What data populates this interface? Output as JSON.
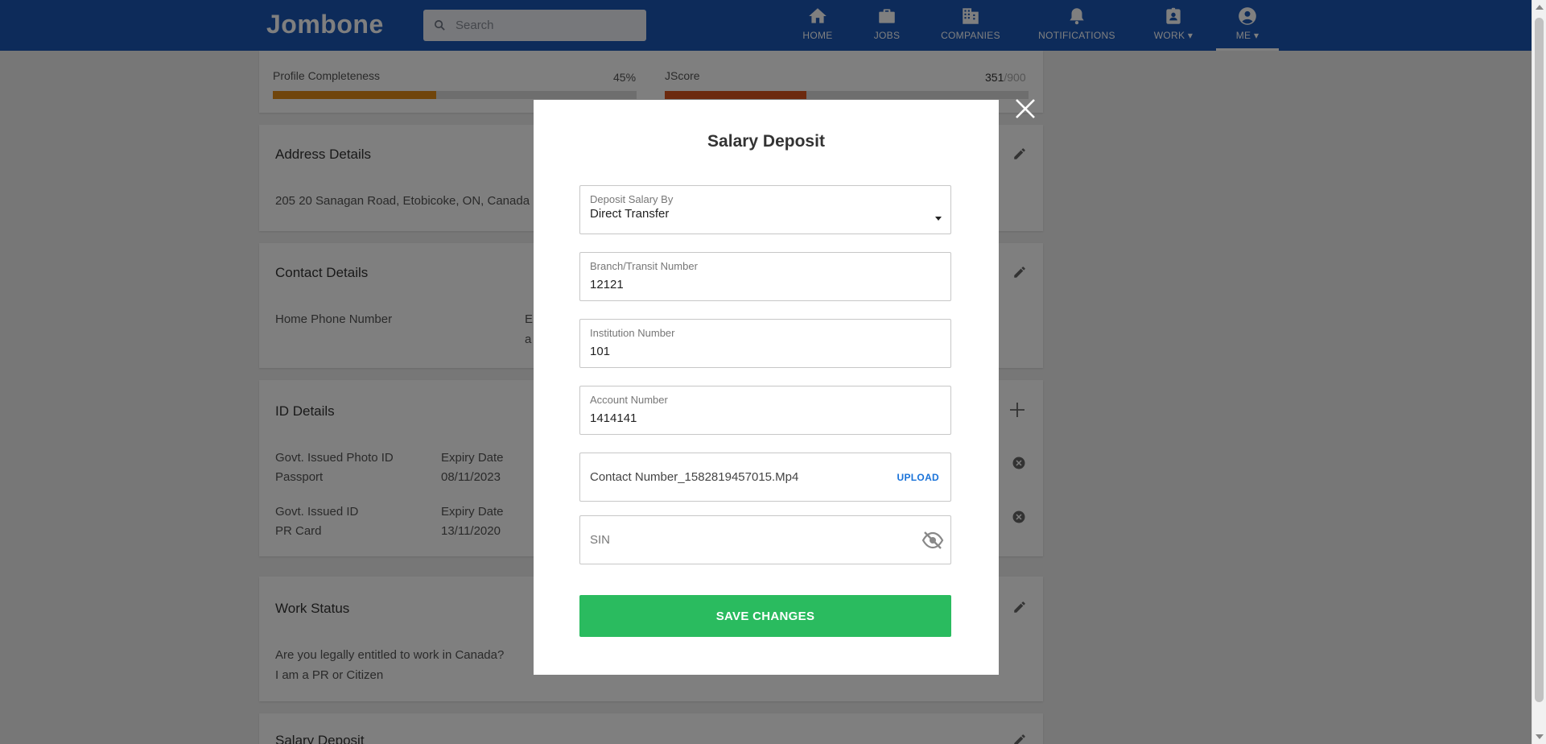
{
  "navbar": {
    "brand": "Jombone",
    "search_placeholder": "Search",
    "items": [
      {
        "label": "HOME",
        "icon": "home-icon"
      },
      {
        "label": "JOBS",
        "icon": "briefcase-icon"
      },
      {
        "label": "COMPANIES",
        "icon": "building-icon"
      },
      {
        "label": "NOTIFICATIONS",
        "icon": "bell-icon"
      },
      {
        "label": "WORK ▾",
        "icon": "work-badge-icon"
      },
      {
        "label": "ME ▾",
        "icon": "account-icon"
      }
    ]
  },
  "progress": {
    "profile_label": "Profile Completeness",
    "profile_value": "45%",
    "profile_fraction": 0.45,
    "jscore_label": "JScore",
    "jscore_value": "351",
    "jscore_max": "/900",
    "jscore_fraction": 0.39
  },
  "address": {
    "title": "Address Details",
    "value": "205 20 Sanagan Road, Etobicoke, ON, Canada"
  },
  "contact": {
    "title": "Contact Details",
    "home_phone_label": "Home Phone Number",
    "partial_e": "E",
    "partial_a": "a"
  },
  "id_details": {
    "title": "ID Details",
    "rows": [
      {
        "type_label": "Govt. Issued Photo ID",
        "type_value": "Passport",
        "expiry_label": "Expiry Date",
        "expiry_value": "08/11/2023"
      },
      {
        "type_label": "Govt. Issued ID",
        "type_value": "PR Card",
        "expiry_label": "Expiry Date",
        "expiry_value": "13/11/2020"
      }
    ]
  },
  "work_status": {
    "title": "Work Status",
    "question": "Are you legally entitled to work in Canada?",
    "answer": "I am a PR or Citizen"
  },
  "salary_card": {
    "title": "Salary Deposit"
  },
  "modal": {
    "title": "Salary Deposit",
    "deposit_by_label": "Deposit Salary By",
    "deposit_by_value": "Direct Transfer",
    "branch_label": "Branch/Transit Number",
    "branch_value": "12121",
    "institution_label": "Institution Number",
    "institution_value": "101",
    "account_label": "Account Number",
    "account_value": "1414141",
    "file_name": "Contact Number_1582819457015.Mp4",
    "upload_label": "UPLOAD",
    "sin_placeholder": "SIN",
    "save_label": "SAVE CHANGES"
  },
  "colors": {
    "navbar": "#1a56b5",
    "progress_orange": "#e08a16",
    "save_green": "#2abb5f",
    "upload_blue": "#1a73d9"
  }
}
